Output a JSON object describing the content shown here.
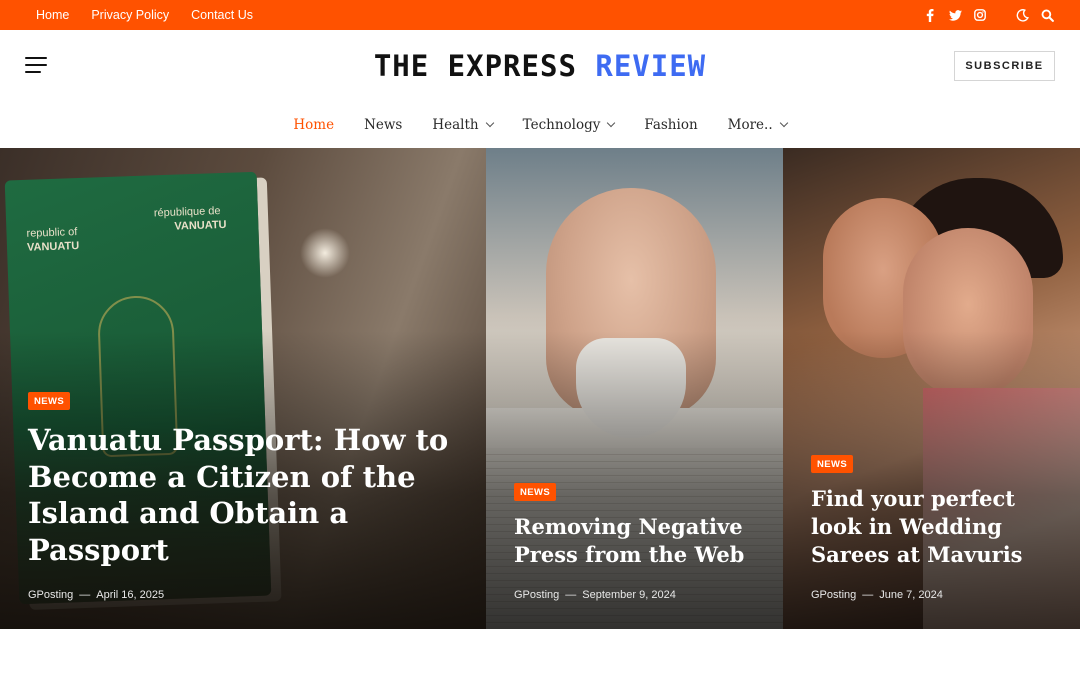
{
  "topbar": {
    "links": [
      "Home",
      "Privacy Policy",
      "Contact Us"
    ],
    "icons": [
      "facebook-icon",
      "twitter-icon",
      "instagram-icon",
      "dark-mode-icon",
      "search-icon"
    ]
  },
  "header": {
    "logo_main": "THE EXPRESS",
    "logo_accent": "REVIEW",
    "subscribe_label": "SUBSCRIBE"
  },
  "nav": {
    "items": [
      "Home",
      "News",
      "Health",
      "Technology",
      "Fashion",
      "More.."
    ]
  },
  "hero": {
    "cards": [
      {
        "category": "NEWS",
        "title": "Vanuatu Passport: How to Become a Citizen of the Island and Obtain a Passport",
        "author": "GPosting",
        "date": "April 16, 2025"
      },
      {
        "category": "NEWS",
        "title": "Removing Negative Press from the Web",
        "author": "GPosting",
        "date": "September 9, 2024"
      },
      {
        "category": "NEWS",
        "title": "Find your perfect look in Wedding Sarees at Mavuris",
        "author": "GPosting",
        "date": "June 7, 2024"
      }
    ],
    "image_texts": {
      "passport_left": "republic of",
      "passport_left_2": "VANUATU",
      "passport_right": "république de",
      "passport_right_2": "VANUATU"
    }
  },
  "colors": {
    "accent": "#ff5200",
    "logo_accent": "#3e6bf2"
  }
}
